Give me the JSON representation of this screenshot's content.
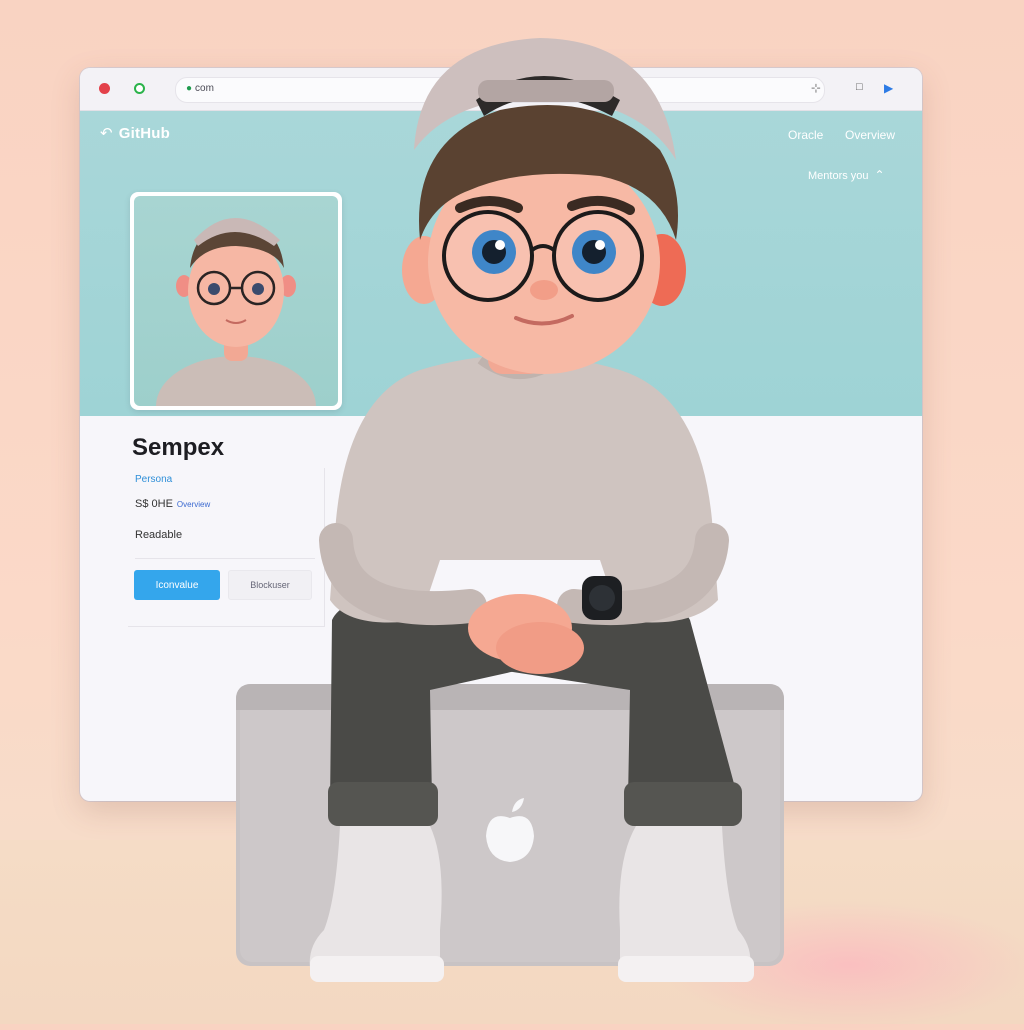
{
  "browser": {
    "url": "com",
    "brand": "GitHub",
    "nav": [
      "Oracle",
      "Overview",
      "Mentors you"
    ]
  },
  "profile": {
    "name": "Sempex",
    "role": "Persona",
    "stats": "S$ 0HE",
    "stats_sub": "Overview",
    "location": "Readable",
    "primary_button": "Iconvalue",
    "secondary_button": "Blockuser"
  },
  "icons": {
    "back": "back-arrow-icon",
    "brand": "github-logo-icon",
    "expand": "chevron-up-icon",
    "window_close": "window-close-dot",
    "window_maximize": "window-maximize-dot",
    "tab": "tab-icon",
    "bookmark": "bookmark-icon",
    "extension": "extension-icon",
    "laptop_logo": "apple-logo-icon"
  },
  "colors": {
    "banner": "#9ed3d5",
    "accent": "#34a6ec",
    "background": "#f9d3c2",
    "laptop": "#c8c3c4",
    "sweater": "#cfc4c0",
    "pants": "#4a4a47",
    "cap": "#cdbfbe"
  }
}
